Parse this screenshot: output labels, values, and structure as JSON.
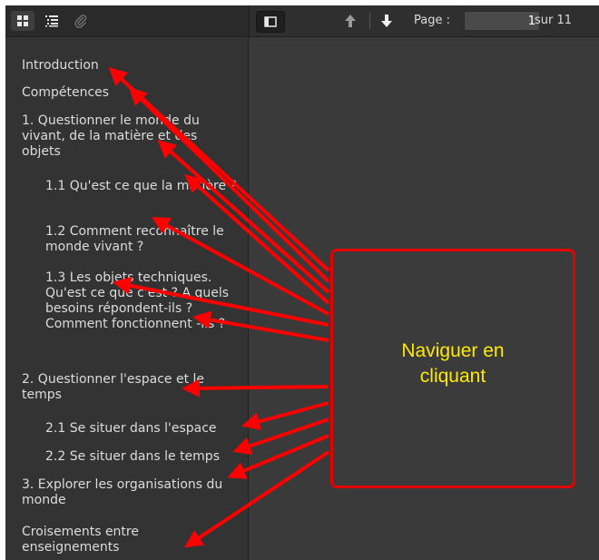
{
  "toolbar": {
    "tabs": [
      {
        "name": "thumbnails-icon"
      },
      {
        "name": "outline-icon"
      },
      {
        "name": "attachments-icon"
      }
    ],
    "page_label": "Page :",
    "page_value": "1",
    "page_total": "sur 11"
  },
  "toc": [
    {
      "label": "Introduction",
      "level": 1
    },
    {
      "label": "Compétences",
      "level": 1
    },
    {
      "label": "1. Questionner le monde du vivant, de la matière et des objets",
      "level": 1
    },
    {
      "label": "1.1 Qu'est ce que la matière ?",
      "level": 2
    },
    {
      "label": "1.2 Comment reconnaître le monde vivant ?",
      "level": 2
    },
    {
      "label": "1.3 Les objets techniques. Qu'est ce que c'est ? A quels besoins répondent-ils ? Comment fonctionnent -ils ?",
      "level": 2
    },
    {
      "label": "2. Questionner l'espace et le temps",
      "level": 1
    },
    {
      "label": "2.1 Se situer dans l'espace",
      "level": 2
    },
    {
      "label": "2.2 Se situer dans le temps",
      "level": 2
    },
    {
      "label": "3. Explorer les organisations du monde",
      "level": 1
    },
    {
      "label": "Croisements entre enseignements",
      "level": 1
    }
  ],
  "callout": {
    "text": "Naviguer en\ncliquant",
    "border_color": "#e60000",
    "text_color": "#ffea00"
  },
  "colors": {
    "arrow": "#ff0000",
    "sidebar_bg": "#333333",
    "viewer_bg": "#3a3a3a"
  }
}
